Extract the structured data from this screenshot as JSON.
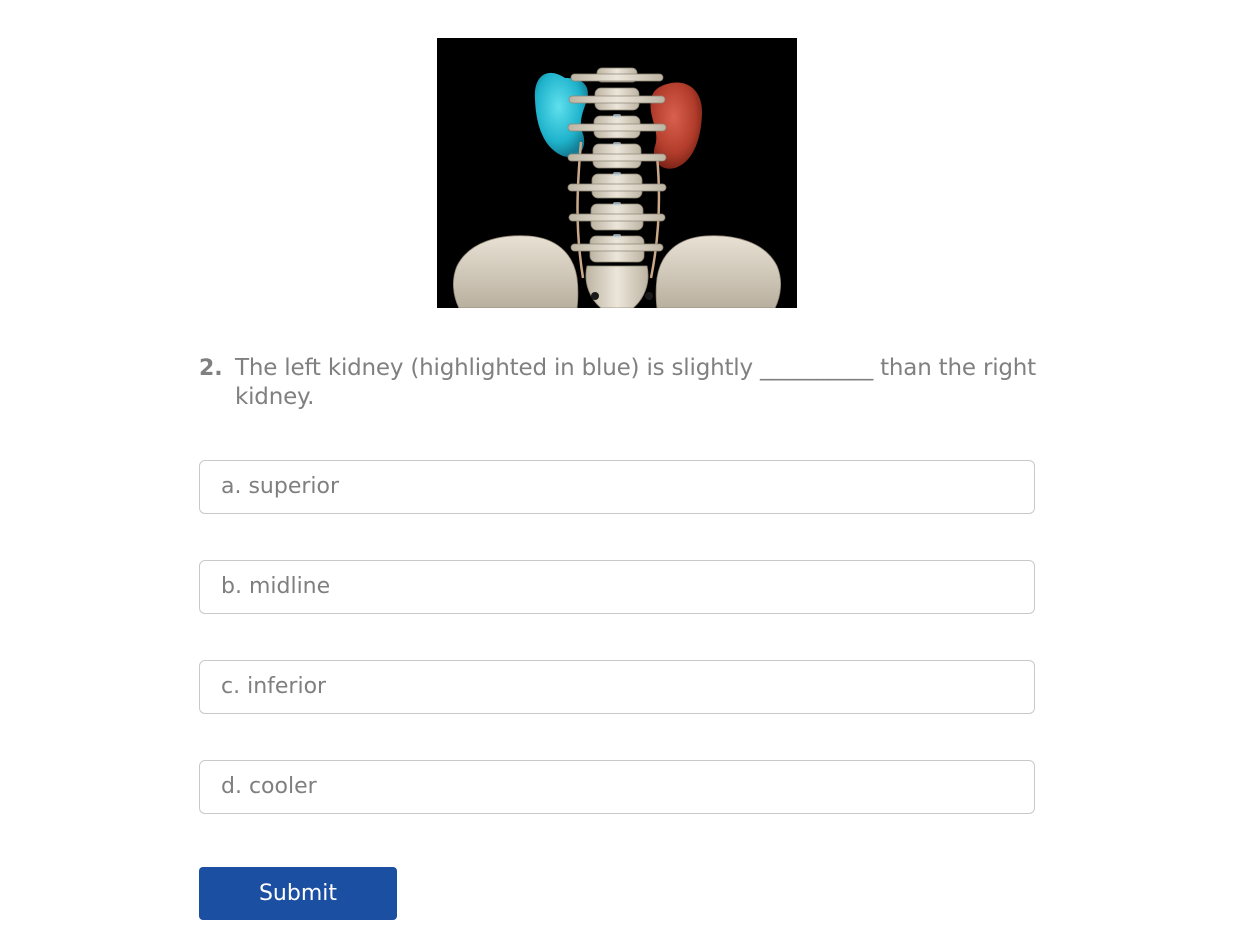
{
  "question": {
    "number": "2.",
    "text": "The left kidney (highlighted in blue) is slightly __________ than the right kidney."
  },
  "figure": {
    "alt": "",
    "colors": {
      "background": "#000000",
      "left_kidney": "#2bb7d1",
      "right_kidney": "#b8402f",
      "bone": "#ddd6c8"
    }
  },
  "options": [
    {
      "label": "a. superior"
    },
    {
      "label": "b. midline"
    },
    {
      "label": "c. inferior"
    },
    {
      "label": "d. cooler"
    }
  ],
  "submit": {
    "label": "Submit"
  },
  "colors": {
    "accent": "#1b4fa1",
    "text": "#808080",
    "border": "#c9c9c9"
  }
}
